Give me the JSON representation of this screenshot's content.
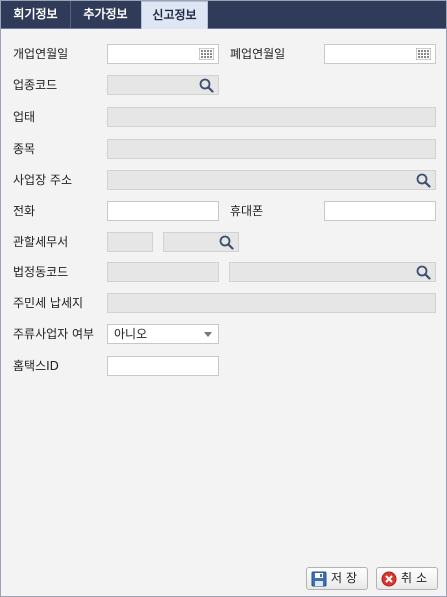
{
  "tabs": [
    {
      "label": "회기정보"
    },
    {
      "label": "추가정보"
    },
    {
      "label": "신고정보"
    }
  ],
  "active_tab": "신고정보",
  "form": {
    "open_date_label": "개업연월일",
    "open_date_value": "",
    "close_date_label": "폐업연월일",
    "close_date_value": "",
    "industry_code_label": "업종코드",
    "industry_code_value": "",
    "business_type_label": "업태",
    "business_type_value": "",
    "business_item_label": "종목",
    "business_item_value": "",
    "address_label": "사업장 주소",
    "address_value": "",
    "phone_label": "전화",
    "phone_value": "",
    "mobile_label": "휴대폰",
    "mobile_value": "",
    "tax_office_label": "관할세무서",
    "tax_office_code": "",
    "tax_office_name": "",
    "legal_dong_label": "법정동코드",
    "legal_dong_code": "",
    "legal_dong_name": "",
    "resident_tax_label": "주민세 납세지",
    "resident_tax_value": "",
    "liquor_label": "주류사업자 여부",
    "liquor_selected": "아니오",
    "hometax_label": "홈택스ID",
    "hometax_value": ""
  },
  "buttons": {
    "save": "저장",
    "cancel": "취소"
  },
  "icons": {
    "calendar": "calendar-icon",
    "search": "search-icon",
    "save": "floppy-disk-icon",
    "cancel": "cancel-x-icon"
  },
  "colors": {
    "tabbar": "#2f3b58",
    "active_tab": "#dfe6f3",
    "readonly_field": "#e6e6e6"
  }
}
